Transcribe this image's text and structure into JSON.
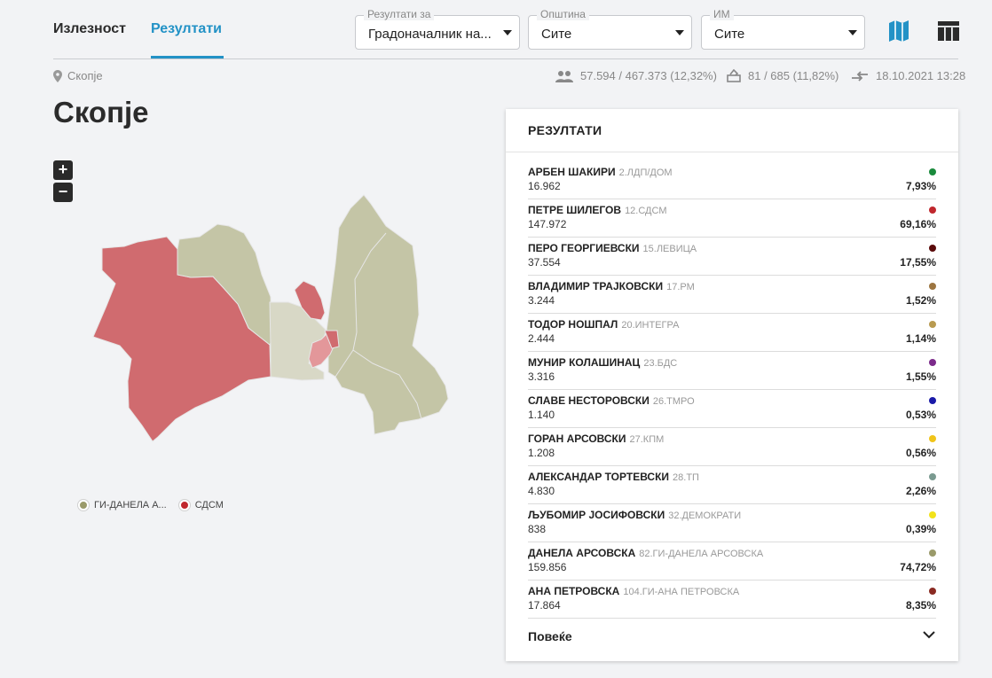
{
  "tabs": {
    "turnout": "Излезност",
    "results": "Резултати"
  },
  "filters": {
    "results_for": {
      "label": "Резултати за",
      "value": "Градоначалник на..."
    },
    "municipality": {
      "label": "Општина",
      "value": "Сите"
    },
    "im": {
      "label": "ИМ",
      "value": "Сите"
    }
  },
  "icons": {
    "map": "map-icon",
    "table": "table-icon",
    "location": "location-pin-icon",
    "voters": "people-icon",
    "stations": "ballot-box-icon",
    "updated": "sync-arrows-icon"
  },
  "info": {
    "location": "Скопје",
    "voters": "57.594 / 467.373 (12,32%)",
    "stations": "81 / 685 (11,82%)",
    "updated": "18.10.2021 13:28"
  },
  "page_title": "Скопје",
  "zoom": {
    "in": "+",
    "out": "−"
  },
  "legend": [
    {
      "label": "ГИ-ДАНЕЛА А...",
      "color": "#9a9a6a"
    },
    {
      "label": "СДСМ",
      "color": "#c0272d"
    }
  ],
  "results": {
    "title": "РЕЗУЛТАТИ",
    "candidates": [
      {
        "name": "АРБЕН ШАКИРИ",
        "party": "2.ЛДП/ДОМ",
        "votes": "16.962",
        "pct": "7,93%",
        "color": "#1a8a3c"
      },
      {
        "name": "ПЕТРЕ ШИЛЕГОВ",
        "party": "12.СДСМ",
        "votes": "147.972",
        "pct": "69,16%",
        "color": "#c0272d"
      },
      {
        "name": "ПЕРО ГЕОРГИЕВСКИ",
        "party": "15.ЛЕВИЦА",
        "votes": "37.554",
        "pct": "17,55%",
        "color": "#5a0a0a"
      },
      {
        "name": "ВЛАДИМИР ТРАЈКОВСКИ",
        "party": "17.РМ",
        "votes": "3.244",
        "pct": "1,52%",
        "color": "#9c7540"
      },
      {
        "name": "ТОДОР НОШПАЛ",
        "party": "20.ИНТЕГРА",
        "votes": "2.444",
        "pct": "1,14%",
        "color": "#b89a50"
      },
      {
        "name": "МУНИР КОЛАШИНАЦ",
        "party": "23.БДС",
        "votes": "3.316",
        "pct": "1,55%",
        "color": "#7b2a8a"
      },
      {
        "name": "СЛАВЕ НЕСТОРОВСКИ",
        "party": "26.ТМРО",
        "votes": "1.140",
        "pct": "0,53%",
        "color": "#1a1aa8"
      },
      {
        "name": "ГОРАН АРСОВСКИ",
        "party": "27.КПМ",
        "votes": "1.208",
        "pct": "0,56%",
        "color": "#f0c419"
      },
      {
        "name": "АЛЕКСАНДАР ТОРТЕВСКИ",
        "party": "28.ТП",
        "votes": "4.830",
        "pct": "2,26%",
        "color": "#7a9a90"
      },
      {
        "name": "ЉУБОМИР ЈОСИФОВСКИ",
        "party": "32.ДЕМОКРАТИ",
        "votes": "838",
        "pct": "0,39%",
        "color": "#f2e21a"
      },
      {
        "name": "ДАНЕЛА АРСОВСКА",
        "party": "82.ГИ-ДАНЕЛА АРСОВСКА",
        "votes": "159.856",
        "pct": "74,72%",
        "color": "#9a9a6a"
      },
      {
        "name": "АНА ПЕТРОВСКА",
        "party": "104.ГИ-АНА ПЕТРОВСКА",
        "votes": "17.864",
        "pct": "8,35%",
        "color": "#8a2a22"
      }
    ],
    "more": "Повеќе"
  }
}
